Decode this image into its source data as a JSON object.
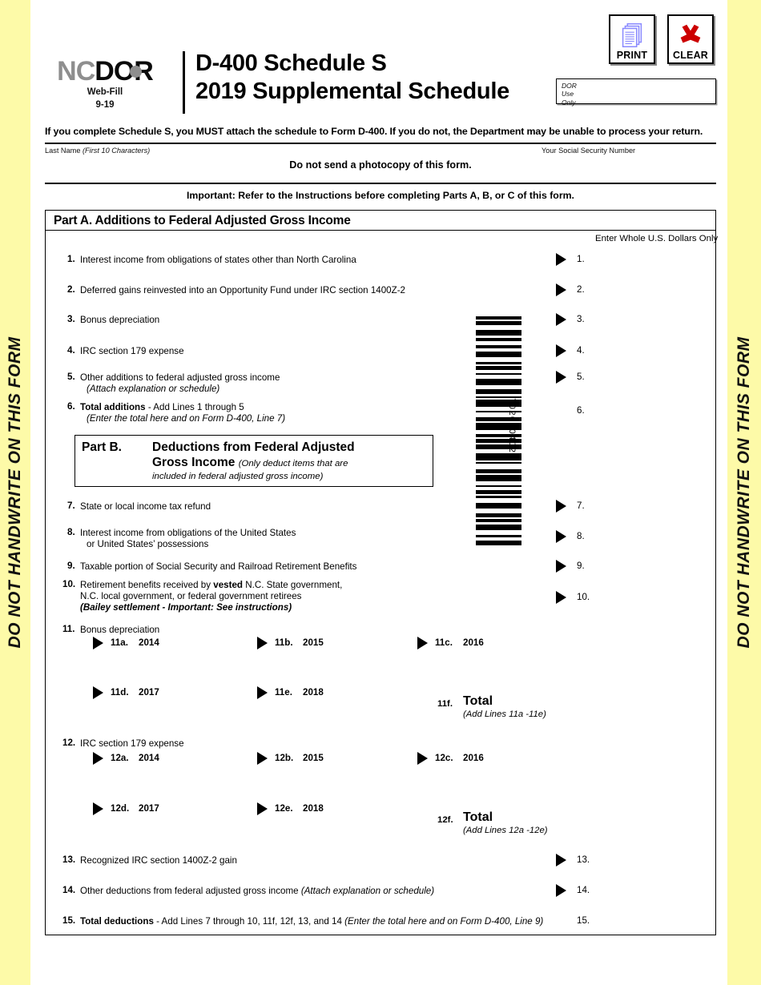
{
  "margins": {
    "warning_text": "DO NOT HANDWRITE ON THIS FORM",
    "color": "#fdfaa8"
  },
  "header": {
    "logo": {
      "nc": "NC",
      "dor": "DOR",
      "webfill": "Web-Fill",
      "revision": "9-19"
    },
    "title_line1": "D-400 Schedule S",
    "title_line2": "2019 Supplemental Schedule",
    "print_button": {
      "label": "PRINT",
      "icon": "print-pages-icon",
      "icon_color": "#8a8aff"
    },
    "clear_button": {
      "label": "CLEAR",
      "icon": "red-x-icon",
      "icon_color": "#cc0000"
    },
    "dor_box": {
      "line1": "DOR",
      "line2": "Use",
      "line3": "Only"
    }
  },
  "notices": {
    "must_attach": "If you complete Schedule S, you MUST attach the schedule to Form D-400.  If you do not, the Department may be unable to process your return.",
    "last_name_label": "Last Name",
    "last_name_hint": "(First 10 Characters)",
    "ssn_label": "Your Social Security Number",
    "photocopy": "Do not send a photocopy of this form.",
    "important": "Important:  Refer to the Instructions before completing Parts A, B, or C of this form."
  },
  "partA": {
    "title": "Part A.  Additions to Federal Adjusted Gross Income",
    "enter_whole_dollars": "Enter Whole U.S. Dollars Only",
    "lines": [
      {
        "num": "1.",
        "text": "Interest income from obligations of states other than North Carolina",
        "amount_label": "1.",
        "arrow": true
      },
      {
        "num": "2.",
        "text": "Deferred gains reinvested into an Opportunity Fund under IRC section 1400Z-2",
        "amount_label": "2.",
        "arrow": true
      },
      {
        "num": "3.",
        "text": "Bonus depreciation",
        "amount_label": "3.",
        "arrow": true
      },
      {
        "num": "4.",
        "text": "IRC section 179 expense",
        "amount_label": "4.",
        "arrow": true
      },
      {
        "num": "5.",
        "text": "Other additions to federal adjusted gross income",
        "text2": "(Attach explanation or schedule)",
        "amount_label": "5.",
        "arrow": true
      },
      {
        "num": "6.",
        "text_bold": "Total additions",
        "text": " - Add Lines 1 through 5",
        "text2": "(Enter the total here and on Form D-400, Line 7)",
        "amount_label": "6.",
        "arrow": false
      }
    ]
  },
  "partB": {
    "label": "Part B.",
    "heading_line1": "Deductions from Federal Adjusted",
    "heading_line2": "Gross Income",
    "note_line1": "(Only deduct items that are",
    "note_line2": "included in federal adjusted gross income)",
    "lines": [
      {
        "num": "7.",
        "text": "State or local income tax refund",
        "amount_label": "7.",
        "arrow": true
      },
      {
        "num": "8.",
        "text": "Interest income from obligations of the United States",
        "text2": "or United States’ possessions",
        "amount_label": "8.",
        "arrow": true
      },
      {
        "num": "9.",
        "text": "Taxable portion of Social Security and Railroad Retirement Benefits",
        "amount_label": "9.",
        "arrow": true
      },
      {
        "num": "10.",
        "text": "Retirement benefits received by ",
        "text_bold": "vested",
        "text_after": " N.C. State government,",
        "text2": "N.C. local government, or federal government retirees",
        "text3": "(Bailey settlement - Important:  See instructions)",
        "amount_label": "10.",
        "arrow": true
      },
      {
        "num": "13.",
        "text": "Recognized IRC section 1400Z-2 gain",
        "amount_label": "13.",
        "arrow": true
      },
      {
        "num": "14.",
        "text": "Other deductions from federal adjusted gross income ",
        "text_italic": "(Attach explanation or schedule)",
        "amount_label": "14.",
        "arrow": true
      },
      {
        "num": "15.",
        "text_bold": "Total deductions",
        "text": " - Add Lines 7 through 10, 11f, 12f, 13, and 14  ",
        "text_italic": "(Enter the total here and on Form D-400, Line 9)",
        "amount_label": "15.",
        "arrow": false
      }
    ],
    "line11": {
      "num": "11.",
      "title": "Bonus depreciation",
      "subs": [
        {
          "id": "11a.",
          "year": "2014"
        },
        {
          "id": "11b.",
          "year": "2015"
        },
        {
          "id": "11c.",
          "year": "2016"
        },
        {
          "id": "11d.",
          "year": "2017"
        },
        {
          "id": "11e.",
          "year": "2018"
        }
      ],
      "total_tag": "11f.",
      "total_word": "Total",
      "total_sub": "(Add Lines 11a -11e)"
    },
    "line12": {
      "num": "12.",
      "title": "IRC section 179 expense",
      "subs": [
        {
          "id": "12a.",
          "year": "2014"
        },
        {
          "id": "12b.",
          "year": "2015"
        },
        {
          "id": "12c.",
          "year": "2016"
        },
        {
          "id": "12d.",
          "year": "2017"
        },
        {
          "id": "12e.",
          "year": "2018"
        }
      ],
      "total_tag": "12f.",
      "total_word": "Total",
      "total_sub": "(Add Lines 12a -12e)"
    }
  },
  "barcode": {
    "number": "7020704021"
  }
}
